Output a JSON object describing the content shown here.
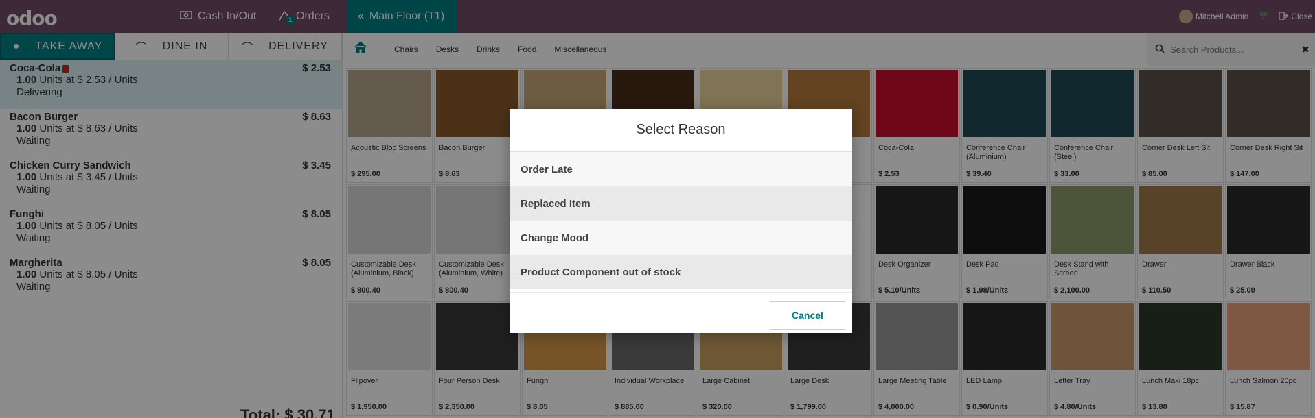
{
  "navbar": {
    "logo": "odoo",
    "cash_label": "Cash In/Out",
    "orders_label": "Orders",
    "orders_badge": "1",
    "floor_label": "Main Floor (T1)",
    "user_name": "Mitchell Admin",
    "close_label": "Close"
  },
  "modes": [
    "TAKE AWAY",
    "DINE IN",
    "DELIVERY"
  ],
  "order_lines": [
    {
      "name": "Coca-Cola",
      "price": "$ 2.53",
      "qty": "1.00",
      "detail": "Units at $ 2.53 / Units",
      "status": "Delivering"
    },
    {
      "name": "Bacon Burger",
      "price": "$ 8.63",
      "qty": "1.00",
      "detail": "Units at $ 8.63 / Units",
      "status": "Waiting"
    },
    {
      "name": "Chicken Curry Sandwich",
      "price": "$ 3.45",
      "qty": "1.00",
      "detail": "Units at $ 3.45 / Units",
      "status": "Waiting"
    },
    {
      "name": "Funghi",
      "price": "$ 8.05",
      "qty": "1.00",
      "detail": "Units at $ 8.05 / Units",
      "status": "Waiting"
    },
    {
      "name": "Margherita",
      "price": "$ 8.05",
      "qty": "1.00",
      "detail": "Units at $ 8.05 / Units",
      "status": "Waiting"
    }
  ],
  "total": "Total: $ 30.71",
  "categories": [
    "Chairs",
    "Desks",
    "Drinks",
    "Food",
    "Miscellaneous"
  ],
  "search": {
    "placeholder": "Search Products..."
  },
  "products": [
    {
      "name": "Acoustic Bloc Screens",
      "price": "$ 295.00",
      "color": "#b9a68c"
    },
    {
      "name": "Bacon Burger",
      "price": "$ 8.63",
      "color": "#8a5a2b"
    },
    {
      "name": "",
      "price": "",
      "color": "#c9a878"
    },
    {
      "name": "",
      "price": "",
      "color": "#4a2e1a"
    },
    {
      "name": "",
      "price": "",
      "color": "#e8d49a"
    },
    {
      "name": "",
      "price": "",
      "color": "#b57a3c"
    },
    {
      "name": "Coca-Cola",
      "price": "$ 2.53",
      "color": "#c8102e"
    },
    {
      "name": "Conference Chair (Aluminium)",
      "price": "$ 39.40",
      "color": "#1f4a55"
    },
    {
      "name": "Conference Chair (Steel)",
      "price": "$ 33.00",
      "color": "#1f4a55"
    },
    {
      "name": "Corner Desk Left Sit",
      "price": "$ 85.00",
      "color": "#5a5048"
    },
    {
      "name": "Corner Desk Right Sit",
      "price": "$ 147.00",
      "color": "#5a5048"
    },
    {
      "name": "Customizable Desk (Aluminium, Black)",
      "price": "$ 800.40",
      "color": "#d8d8d8"
    },
    {
      "name": "Customizable Desk (Aluminium, White)",
      "price": "$ 800.40",
      "color": "#d8d8d8"
    },
    {
      "name": "",
      "price": "",
      "color": "#ffffff"
    },
    {
      "name": "",
      "price": "",
      "color": "#ffffff"
    },
    {
      "name": "",
      "price": "",
      "color": "#ffffff"
    },
    {
      "name": "",
      "price": "",
      "color": "#ffffff"
    },
    {
      "name": "Desk Organizer",
      "price": "$ 5.10/Units",
      "color": "#2a2a2a"
    },
    {
      "name": "Desk Pad",
      "price": "$ 1.98/Units",
      "color": "#1a1a1a"
    },
    {
      "name": "Desk Stand with Screen",
      "price": "$ 2,100.00",
      "color": "#8a9a6a"
    },
    {
      "name": "Drawer",
      "price": "$ 110.50",
      "color": "#a07a4a"
    },
    {
      "name": "Drawer Black",
      "price": "$ 25.00",
      "color": "#2a2a2a"
    },
    {
      "name": "Flipover",
      "price": "$ 1,950.00",
      "color": "#e0e0e0"
    },
    {
      "name": "Four Person Desk",
      "price": "$ 2,350.00",
      "color": "#3a3a3a"
    },
    {
      "name": "Funghi",
      "price": "$ 8.05",
      "color": "#d89a4a"
    },
    {
      "name": "Individual Workplace",
      "price": "$ 885.00",
      "color": "#6a6a6a"
    },
    {
      "name": "Large Cabinet",
      "price": "$ 320.00",
      "color": "#c8a060"
    },
    {
      "name": "Large Desk",
      "price": "$ 1,799.00",
      "color": "#3a3a3a"
    },
    {
      "name": "Large Meeting Table",
      "price": "$ 4,000.00",
      "color": "#9a9a9a"
    },
    {
      "name": "LED Lamp",
      "price": "$ 0.90/Units",
      "color": "#2a2a2a"
    },
    {
      "name": "Letter Tray",
      "price": "$ 4.80/Units",
      "color": "#c89a6a"
    },
    {
      "name": "Lunch Maki 18pc",
      "price": "$ 13.80",
      "color": "#2a3a2a"
    },
    {
      "name": "Lunch Salmon 20pc",
      "price": "$ 15.87",
      "color": "#e8a07a"
    }
  ],
  "modal": {
    "title": "Select Reason",
    "reasons": [
      "Order Late",
      "Replaced Item",
      "Change Mood",
      "Product Component out of stock"
    ],
    "cancel_label": "Cancel"
  },
  "colors": {
    "brand": "#714B67",
    "accent": "#017E84"
  }
}
